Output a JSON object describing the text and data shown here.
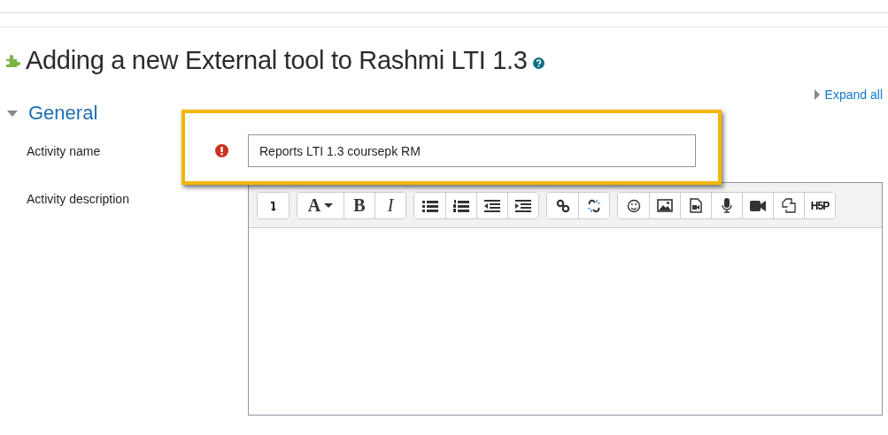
{
  "page": {
    "title": "Adding a new External tool to Rashmi LTI 1.3",
    "expand_all": "Expand all"
  },
  "section": {
    "title": "General",
    "expanded": true
  },
  "fields": [
    {
      "label": "Activity name",
      "kind": "text",
      "value": "Reports LTI 1.3 coursepk RM",
      "error": true,
      "highlighted": true
    },
    {
      "label": "Activity description",
      "kind": "editor",
      "error": false,
      "highlighted": false,
      "toolbar_groups": [
        {
          "buttons": [
            {
              "kind": "icon"
            }
          ]
        },
        {
          "buttons": [
            {
              "kind": "dropdown",
              "label": "A"
            },
            {
              "kind": "bold",
              "label": "B"
            },
            {
              "kind": "italic",
              "label": "I"
            }
          ]
        },
        {
          "buttons": [
            {
              "kind": "icon"
            },
            {
              "kind": "icon"
            },
            {
              "kind": "icon"
            },
            {
              "kind": "icon"
            }
          ]
        },
        {
          "buttons": [
            {
              "kind": "icon"
            },
            {
              "kind": "icon"
            }
          ]
        },
        {
          "buttons": [
            {
              "kind": "icon"
            },
            {
              "kind": "icon"
            },
            {
              "kind": "icon"
            },
            {
              "kind": "icon"
            },
            {
              "kind": "icon"
            },
            {
              "kind": "icon"
            },
            {
              "kind": "logo",
              "label": "H5P"
            }
          ]
        }
      ]
    }
  ]
}
